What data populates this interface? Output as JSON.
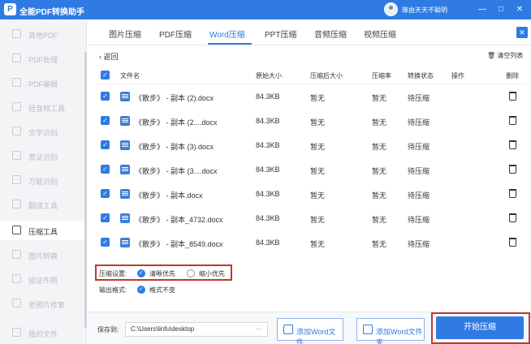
{
  "app": {
    "title": "全能PDF转换助手",
    "user": "琢由天天不聪明"
  },
  "window": {
    "minimize": "—",
    "maximize": "□",
    "close": "✕"
  },
  "sidebar": {
    "items": [
      {
        "label": "其他PDF",
        "active": false
      },
      {
        "label": "PDF处理",
        "active": false
      },
      {
        "label": "PDF编辑",
        "active": false
      },
      {
        "label": "轻音频工具",
        "active": false
      },
      {
        "label": "文字识别",
        "active": false
      },
      {
        "label": "票证识别",
        "active": false
      },
      {
        "label": "万能识别",
        "active": false
      },
      {
        "label": "翻译工具",
        "active": false
      },
      {
        "label": "压缩工具",
        "active": true
      },
      {
        "label": "图片转换",
        "active": false
      },
      {
        "label": "拍证件照",
        "active": false
      },
      {
        "label": "老照片修复",
        "active": false
      },
      {
        "label": "我的文件",
        "active": false
      }
    ]
  },
  "tabs": [
    {
      "label": "图片压缩",
      "active": false
    },
    {
      "label": "PDF压缩",
      "active": false
    },
    {
      "label": "Word压缩",
      "active": true
    },
    {
      "label": "PPT压缩",
      "active": false
    },
    {
      "label": "音频压缩",
      "active": false
    },
    {
      "label": "视频压缩",
      "active": false
    }
  ],
  "toolbar": {
    "back": "返回",
    "clear": "清空列表"
  },
  "table": {
    "headers": {
      "name": "文件名",
      "orig": "原始大小",
      "comp": "压缩后大小",
      "ratio": "压缩率",
      "status": "转换状态",
      "op": "操作",
      "del": "删除"
    },
    "rows": [
      {
        "name": "《散步》 - 副本 (2).docx",
        "orig": "84.3KB",
        "comp": "暂无",
        "ratio": "暂无",
        "status": "待压缩"
      },
      {
        "name": "《散步》 - 副本 (2....docx",
        "orig": "84.3KB",
        "comp": "暂无",
        "ratio": "暂无",
        "status": "待压缩"
      },
      {
        "name": "《散步》 - 副本 (3).docx",
        "orig": "84.3KB",
        "comp": "暂无",
        "ratio": "暂无",
        "status": "待压缩"
      },
      {
        "name": "《散步》 - 副本 (3....docx",
        "orig": "84.3KB",
        "comp": "暂无",
        "ratio": "暂无",
        "status": "待压缩"
      },
      {
        "name": "《散步》 - 副本.docx",
        "orig": "84.3KB",
        "comp": "暂无",
        "ratio": "暂无",
        "status": "待压缩"
      },
      {
        "name": "《散步》 - 副本_4732.docx",
        "orig": "84.3KB",
        "comp": "暂无",
        "ratio": "暂无",
        "status": "待压缩"
      },
      {
        "name": "《散步》 - 副本_8549.docx",
        "orig": "84.3KB",
        "comp": "暂无",
        "ratio": "暂无",
        "status": "待压缩"
      }
    ]
  },
  "options": {
    "compress_label": "压缩设置:",
    "clear_first": "清晰优先",
    "small_first": "缩小优先",
    "output_label": "输出格式:",
    "keep_format": "格式不变"
  },
  "footer": {
    "save_label": "保存到:",
    "save_path": "C:\\Users\\linfu\\desktop",
    "browse": "···",
    "add_word": "添加Word文件",
    "add_folder": "添加Word文件夹",
    "start": "开始压缩"
  },
  "colors": {
    "accent": "#2f7be3",
    "highlight": "#c0392b"
  }
}
